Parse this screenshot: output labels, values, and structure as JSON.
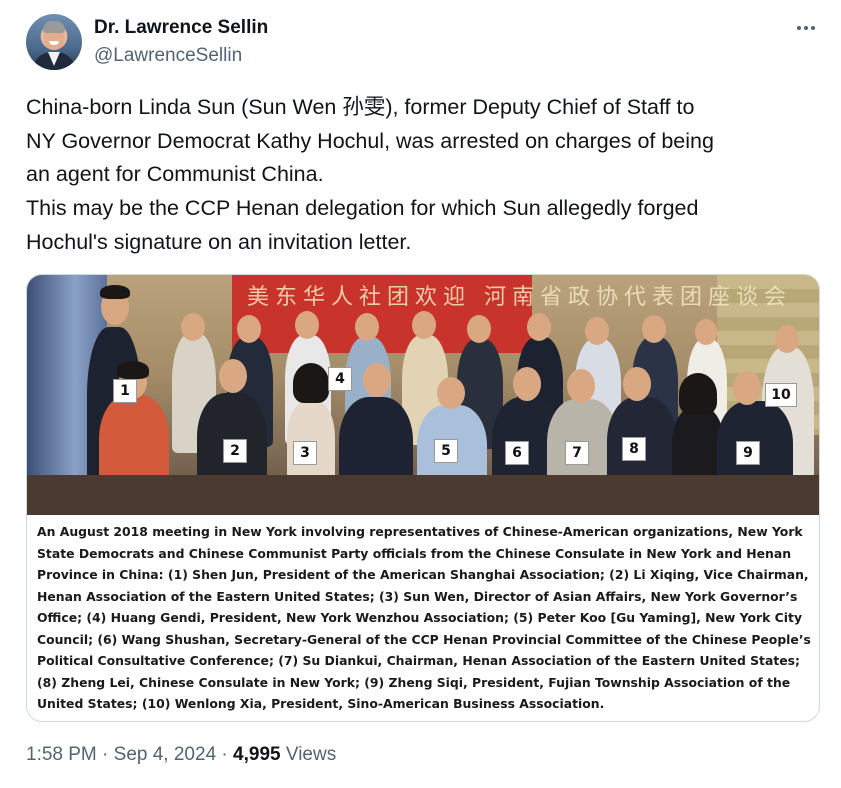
{
  "author": {
    "display_name": "Dr. Lawrence Sellin",
    "handle": "@LawrenceSellin"
  },
  "tweet_lines": [
    "China-born Linda Sun (Sun Wen 孙雯), former Deputy Chief of Staff to",
    "NY Governor Democrat Kathy Hochul, was arrested on charges of being",
    "an agent for Communist China.",
    "This may be the CCP Henan delegation for which Sun allegedly forged",
    "Hochul's signature on an invitation letter."
  ],
  "media": {
    "banner_text": "美东华人社团欢迎 河南省政协代表团座谈会",
    "number_labels": [
      "1",
      "2",
      "3",
      "4",
      "5",
      "6",
      "7",
      "8",
      "9",
      "10"
    ],
    "caption_lines": [
      "An August 2018 meeting in New York involving representatives of Chinese-American organizations, New York",
      "State Democrats and Chinese Communist Party officials from the Chinese Consulate in New York and Henan",
      "Province in China: (1) Shen Jun, President of the American Shanghai Association; (2) Li Xiqing, Vice Chairman,",
      "Henan Association of the Eastern United States; (3) Sun Wen, Director of Asian Affairs, New York Governor’s",
      "Office; (4) Huang Gendi, President, New York Wenzhou Association; (5) Peter Koo [Gu Yaming], New York City",
      "Council; (6) Wang Shushan, Secretary-General of the CCP Henan Provincial Committee of the Chinese People’s",
      "Political Consultative Conference; (7) Su Diankui, Chairman, Henan Association of the Eastern United States;",
      "(8) Zheng Lei, Chinese Consulate in New York; (9) Zheng Siqi, President, Fujian Township Association of the",
      "United States; (10) Wenlong Xia, President, Sino-American Business Association."
    ]
  },
  "footer": {
    "time": "1:58 PM",
    "separator": "·",
    "date": "Sep 4, 2024",
    "views_count": "4,995",
    "views_label": "Views"
  },
  "icons": {
    "more": "more-horizontal-icon"
  },
  "colors": {
    "text_primary": "#0f1419",
    "text_secondary": "#536471",
    "border": "#cfd9de"
  }
}
